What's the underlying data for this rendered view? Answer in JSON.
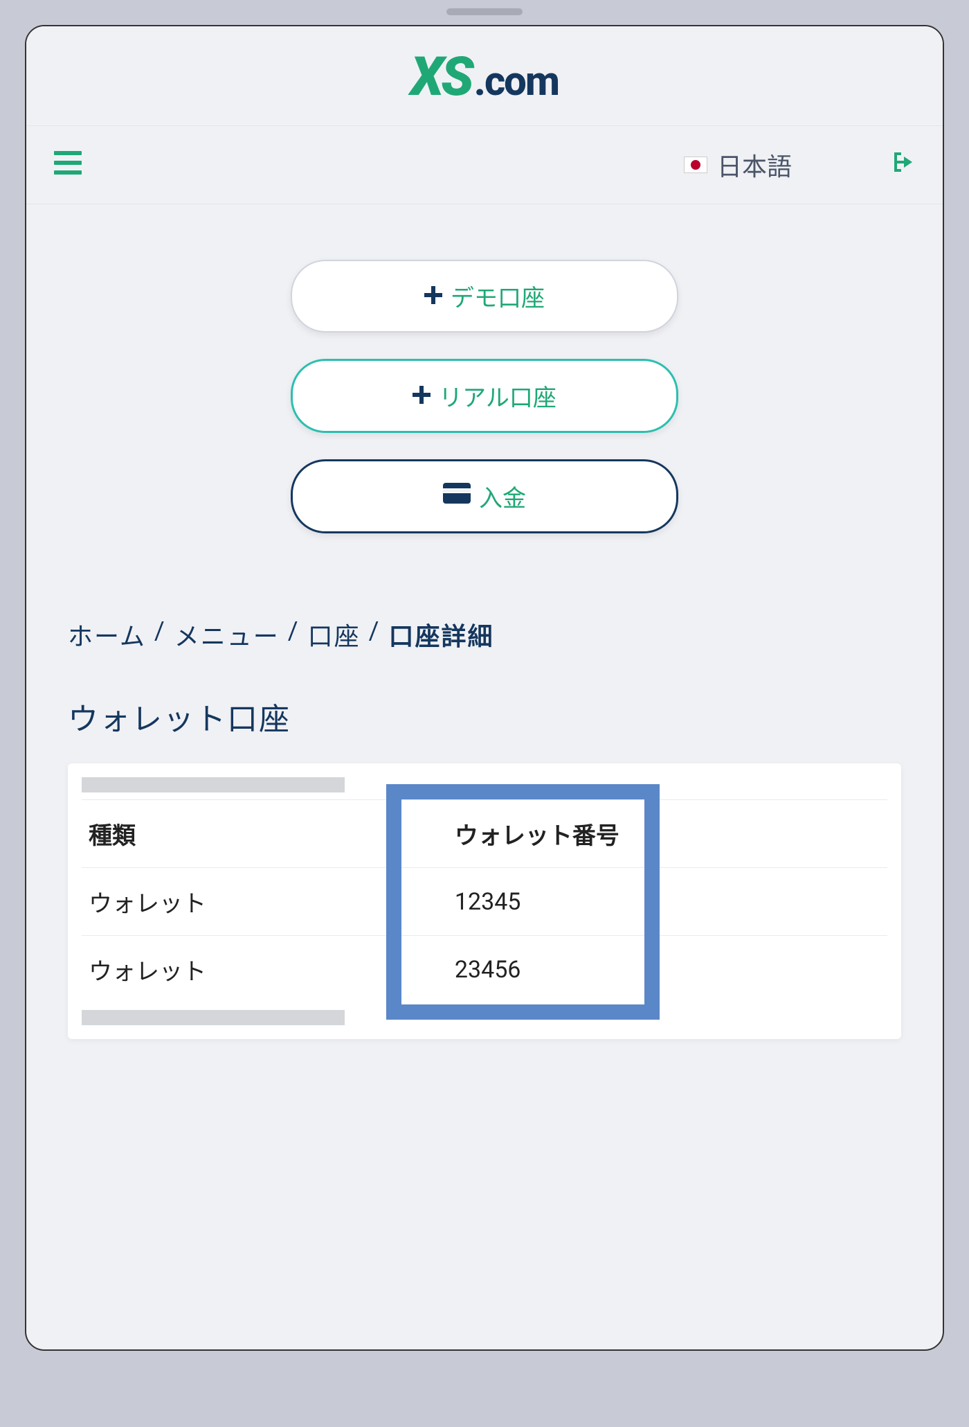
{
  "logo": {
    "brand": "XS",
    "suffix": ".com"
  },
  "topbar": {
    "language": "日本語"
  },
  "actions": {
    "demo": "デモ口座",
    "real": "リアル口座",
    "deposit": "入金"
  },
  "breadcrumb": {
    "items": [
      "ホーム",
      "メニュー",
      "口座"
    ],
    "current": "口座詳細"
  },
  "section": {
    "title": "ウォレット口座"
  },
  "table": {
    "headers": {
      "type": "種類",
      "number": "ウォレット番号"
    },
    "rows": [
      {
        "type": "ウォレット",
        "number": "12345"
      },
      {
        "type": "ウォレット",
        "number": "23456"
      }
    ]
  }
}
